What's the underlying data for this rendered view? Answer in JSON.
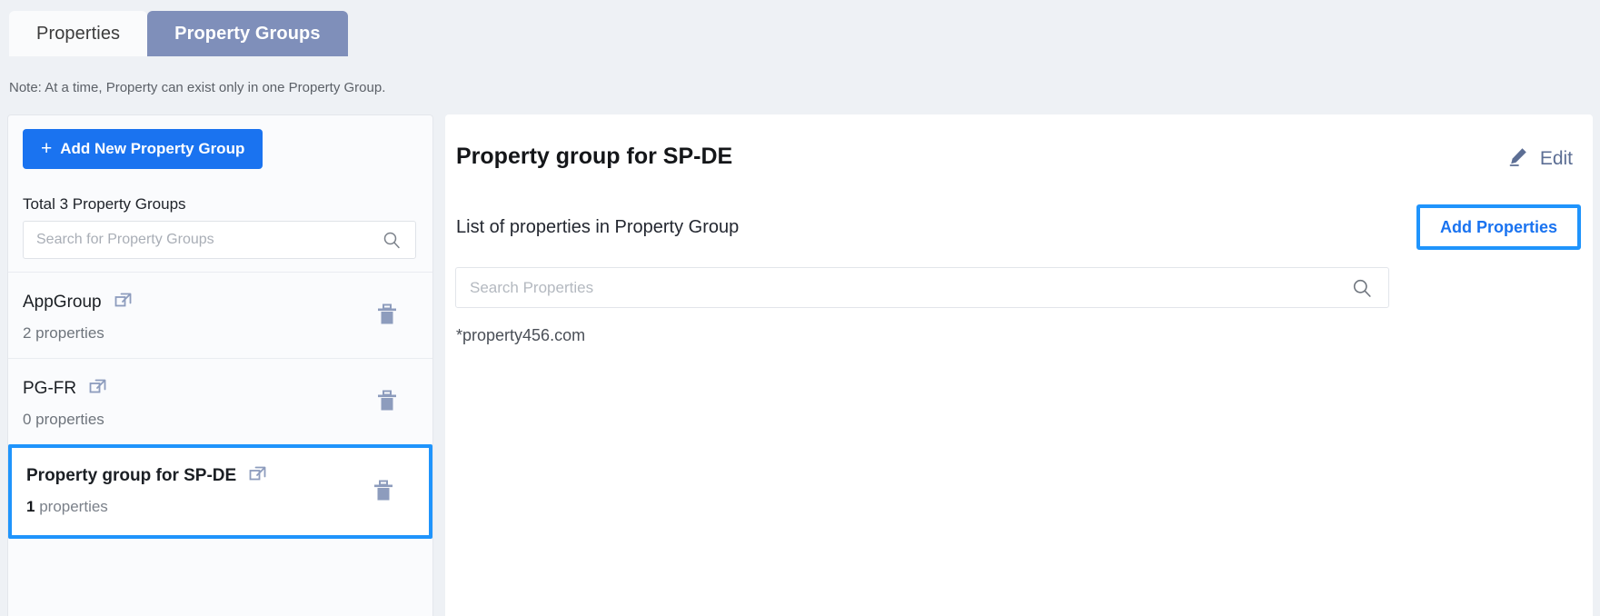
{
  "tabs": [
    {
      "label": "Properties",
      "active": false
    },
    {
      "label": "Property Groups",
      "active": true
    }
  ],
  "note": "Note: At a time, Property can exist only in one Property Group.",
  "sidebar": {
    "add_button_label": "Add New Property Group",
    "add_button_plus": "+",
    "total_label": "Total 3 Property Groups",
    "search_placeholder": "Search for Property Groups",
    "search_value": "",
    "groups": [
      {
        "name": "AppGroup",
        "count_number": "2",
        "count_suffix": "properties",
        "count_text": "2 properties",
        "selected": false
      },
      {
        "name": "PG-FR",
        "count_number": "0",
        "count_suffix": "properties",
        "count_text": "0 properties",
        "selected": false
      },
      {
        "name": "Property group for SP-DE",
        "count_number": "1",
        "count_suffix": "properties",
        "count_text": "1 properties",
        "selected": true
      }
    ]
  },
  "main": {
    "title": "Property group for SP-DE",
    "edit_label": "Edit",
    "list_label": "List of properties in Property Group",
    "add_properties_label": "Add Properties",
    "search_placeholder": "Search Properties",
    "search_value": "",
    "properties": [
      {
        "name": "*property456.com"
      }
    ]
  },
  "colors": {
    "accent_blue": "#1a73f0",
    "highlight_blue": "#1f94fc",
    "active_tab": "#7f8fba",
    "icon_slate": "#8d9cbd",
    "page_bg": "#eef1f5"
  }
}
